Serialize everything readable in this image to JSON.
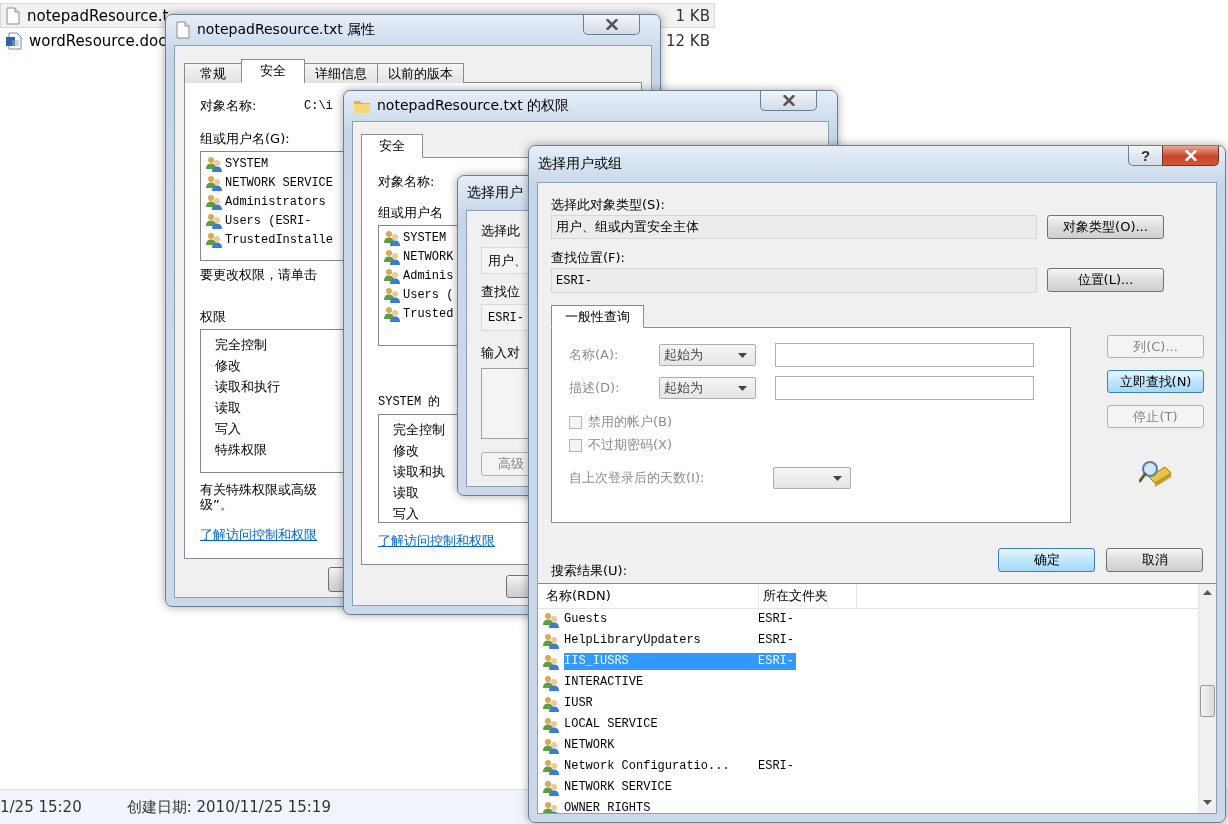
{
  "explorer": {
    "files": [
      {
        "name": "notepadResource.t",
        "size": "1 KB",
        "selected": true,
        "kind": "text"
      },
      {
        "name": "wordResource.doc",
        "size": "12 KB",
        "selected": false,
        "kind": "word"
      }
    ],
    "status": [
      "1/25 15:20",
      "创建日期: 2010/11/25 15:19"
    ]
  },
  "properties_window": {
    "title": "notepadResource.txt 属性",
    "active": false,
    "tabs": [
      {
        "label": "常规",
        "selected": false
      },
      {
        "label": "安全",
        "selected": true
      },
      {
        "label": "详细信息",
        "selected": false
      },
      {
        "label": "以前的版本",
        "selected": false
      }
    ],
    "object_label": "对象名称:",
    "object_value": "C:\\i",
    "groups_label": "组或用户名(G):",
    "users": [
      "SYSTEM",
      "NETWORK SERVICE",
      "Administrators",
      "Users (ESRI-",
      "TrustedInstalle"
    ],
    "hint": "要更改权限，请单击",
    "permissions_label": "权限",
    "permissions": [
      "完全控制",
      "修改",
      "读取和执行",
      "读取",
      "写入",
      "特殊权限"
    ],
    "note_lines": [
      "有关特殊权限或高级",
      "级”。"
    ],
    "link": "了解访问控制和权限"
  },
  "permissions_window": {
    "title": "notepadResource.txt 的权限",
    "active": false,
    "tabs": [
      {
        "label": "安全",
        "selected": true
      }
    ],
    "object_label": "对象名称:",
    "groups_label": "组或用户名",
    "users": [
      "SYSTEM",
      "NETWORK",
      "Adminis",
      "Users (",
      "Trusted"
    ],
    "permissions_label": "SYSTEM 的",
    "permissions": [
      "完全控制",
      "修改",
      "读取和执",
      "读取",
      "写入"
    ],
    "link": "了解访问控制和权限"
  },
  "select_window_back": {
    "title": "选择用户",
    "type_label": "选择此",
    "type_value": "用户、",
    "location_label": "查找位",
    "location_value": "ESRI-",
    "enter_label": "输入对",
    "advanced_button": "高级"
  },
  "select_dialog": {
    "title": "选择用户或组",
    "active": true,
    "help": "?",
    "type_label": "选择此对象类型(S):",
    "type_value": "用户、组或内置安全主体",
    "type_button": "对象类型(O)...",
    "location_label": "查找位置(F):",
    "location_value": "ESRI-",
    "location_button": "位置(L)...",
    "query_tab": {
      "label": "一般性查询",
      "selected": true
    },
    "query_rows": [
      {
        "label": "名称(A):",
        "option": "起始为",
        "disabled": true
      },
      {
        "label": "描述(D):",
        "option": "起始为",
        "disabled": true
      }
    ],
    "checkboxes": [
      {
        "label": "禁用的帐户(B)",
        "checked": false,
        "disabled": true
      },
      {
        "label": "不过期密码(X)",
        "checked": false,
        "disabled": true
      }
    ],
    "days": {
      "label": "自上次登录后的天数(I):",
      "disabled": true
    },
    "side_buttons": [
      {
        "label": "列(C)...",
        "disabled": true,
        "focused": false
      },
      {
        "label": "立即查找(N)",
        "disabled": false,
        "focused": true
      },
      {
        "label": "停止(T)",
        "disabled": true,
        "focused": false
      }
    ],
    "ok_button": {
      "label": "确定",
      "focused": true
    },
    "cancel_button": {
      "label": "取消",
      "focused": false
    },
    "results_label": "搜索结果(U):",
    "columns": [
      "名称(RDN)",
      "所在文件夹"
    ],
    "results": [
      {
        "name": "Guests",
        "folder": "ESRI-",
        "selected": false
      },
      {
        "name": "HelpLibraryUpdaters",
        "folder": "ESRI-",
        "selected": false
      },
      {
        "name": "IIS_IUSRS",
        "folder": "ESRI-",
        "selected": true
      },
      {
        "name": "INTERACTIVE",
        "selected": false
      },
      {
        "name": "IUSR",
        "selected": false
      },
      {
        "name": "LOCAL SERVICE",
        "selected": false
      },
      {
        "name": "NETWORK",
        "selected": false
      },
      {
        "name": "Network Configuratio...",
        "folder": "ESRI-",
        "selected": false
      },
      {
        "name": "NETWORK SERVICE",
        "selected": false
      },
      {
        "name": "OWNER RIGHTS",
        "selected": false
      }
    ]
  }
}
